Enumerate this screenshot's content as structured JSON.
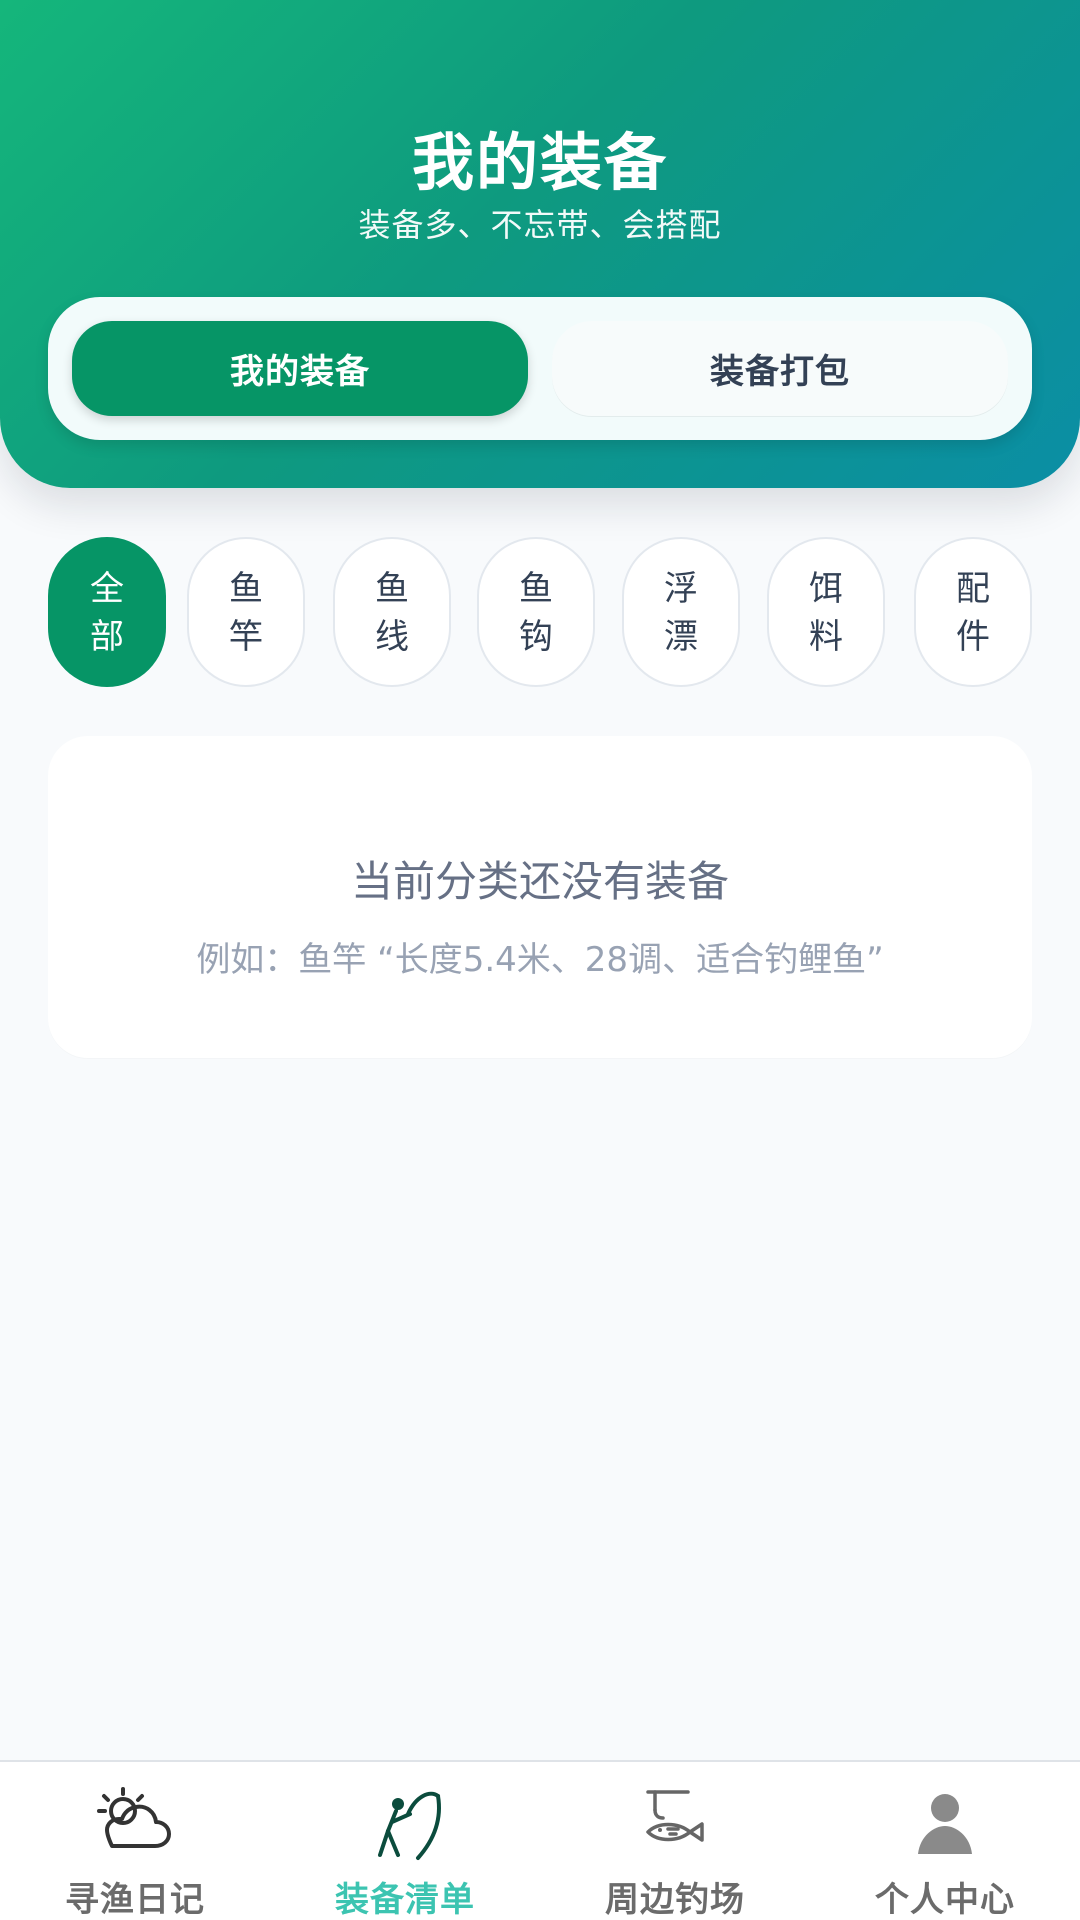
{
  "header": {
    "title": "我的装备",
    "subtitle": "装备多、不忘带、会搭配",
    "tabs": {
      "active": "我的装备",
      "inactive": "装备打包"
    }
  },
  "categories": [
    {
      "label": "全\n部",
      "active": true
    },
    {
      "label": "鱼\n竿",
      "active": false
    },
    {
      "label": "鱼\n线",
      "active": false
    },
    {
      "label": "鱼\n钩",
      "active": false
    },
    {
      "label": "浮\n漂",
      "active": false
    },
    {
      "label": "饵\n料",
      "active": false
    },
    {
      "label": "配\n件",
      "active": false
    }
  ],
  "empty_state": {
    "title": "当前分类还没有装备",
    "hint": "例如：鱼竿 “长度5.4米、28调、适合钓鲤鱼”"
  },
  "bottom_nav": {
    "items": [
      {
        "label": "寻渔日记",
        "icon": "weather-icon",
        "active": false
      },
      {
        "label": "装备清单",
        "icon": "angler-icon",
        "active": true
      },
      {
        "label": "周边钓场",
        "icon": "fish-spot-icon",
        "active": false
      },
      {
        "label": "个人中心",
        "icon": "user-icon",
        "active": false
      }
    ]
  },
  "colors": {
    "primary": "#069566",
    "header_gradient_start": "#15b67b",
    "header_gradient_end": "#0b8ea5",
    "active_nav": "#3cc4b1",
    "inactive_nav": "#6b6b6b"
  }
}
